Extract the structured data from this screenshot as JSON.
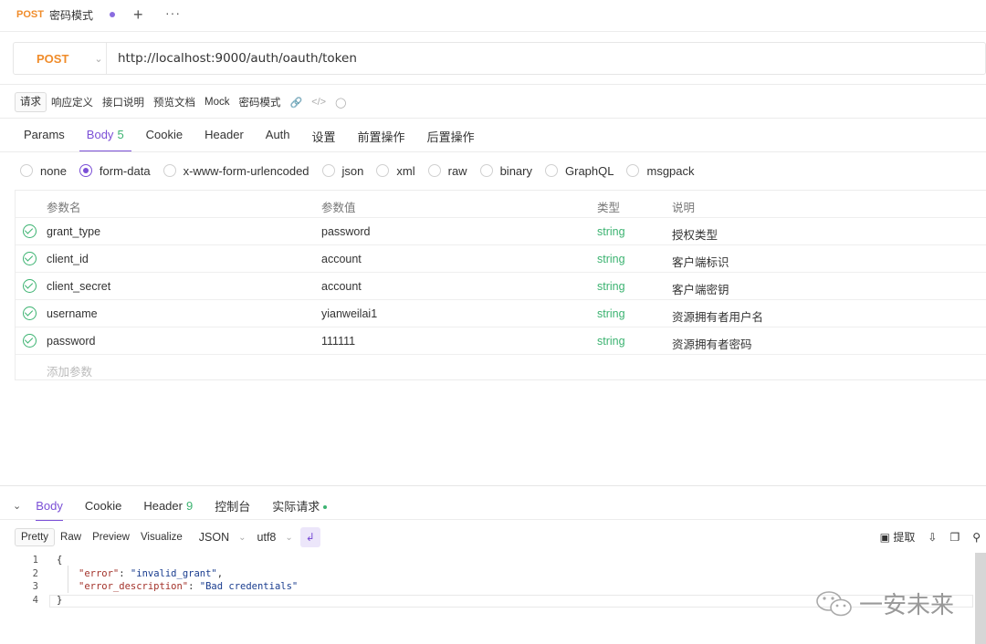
{
  "tab": {
    "method": "POST",
    "title": "密码模式"
  },
  "request": {
    "method": "POST",
    "url": "http://localhost:9000/auth/oauth/token"
  },
  "sub_tabs": [
    "请求",
    "响应定义",
    "接口说明",
    "预览文档",
    "Mock",
    "密码模式"
  ],
  "req_tabs": [
    {
      "label": "Params"
    },
    {
      "label": "Body",
      "badge": "5"
    },
    {
      "label": "Cookie"
    },
    {
      "label": "Header"
    },
    {
      "label": "Auth"
    },
    {
      "label": "设置"
    },
    {
      "label": "前置操作"
    },
    {
      "label": "后置操作"
    }
  ],
  "body_types": [
    "none",
    "form-data",
    "x-www-form-urlencoded",
    "json",
    "xml",
    "raw",
    "binary",
    "GraphQL",
    "msgpack"
  ],
  "selected_body_type": "form-data",
  "params": {
    "headers": [
      "参数名",
      "参数值",
      "类型",
      "说明"
    ],
    "rows": [
      {
        "name": "grant_type",
        "value": "password",
        "type": "string",
        "desc": "授权类型"
      },
      {
        "name": "client_id",
        "value": "account",
        "type": "string",
        "desc": "客户端标识"
      },
      {
        "name": "client_secret",
        "value": "account",
        "type": "string",
        "desc": "客户端密钥"
      },
      {
        "name": "username",
        "value": "yianweilai1",
        "type": "string",
        "desc": "资源拥有者用户名"
      },
      {
        "name": "password",
        "value": "111111",
        "type": "string",
        "desc": "资源拥有者密码"
      }
    ],
    "add_placeholder": "添加参数"
  },
  "response": {
    "tabs": [
      {
        "label": "Body"
      },
      {
        "label": "Cookie"
      },
      {
        "label": "Header",
        "badge": "9"
      },
      {
        "label": "控制台"
      },
      {
        "label": "实际请求"
      }
    ],
    "formats": [
      "Pretty",
      "Raw",
      "Preview",
      "Visualize"
    ],
    "lang": "JSON",
    "encoding": "utf8",
    "extract_label": "提取",
    "code": {
      "line_numbers": [
        "1",
        "2",
        "3",
        "4"
      ],
      "open": "{",
      "error_key": "\"error\"",
      "error_value": "\"invalid_grant\"",
      "desc_key": "\"error_description\"",
      "desc_value": "\"Bad credentials\"",
      "close": "}"
    }
  },
  "watermark": "一安未来"
}
